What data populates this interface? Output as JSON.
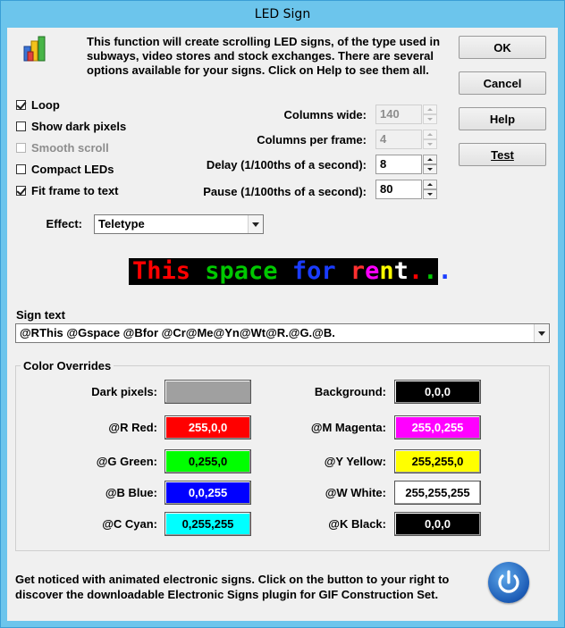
{
  "window": {
    "title": "LED Sign"
  },
  "intro": {
    "line1": "This function will create scrolling LED signs, of the type used in",
    "line2": "subways, video stores and stock exchanges. There are several",
    "line3": "options available for your signs. Click on Help to see them all."
  },
  "buttons": {
    "ok": "OK",
    "cancel": "Cancel",
    "help": "Help",
    "test": "Test"
  },
  "options": [
    {
      "label": "Loop",
      "checked": true,
      "disabled": false
    },
    {
      "label": "Show dark pixels",
      "checked": false,
      "disabled": false
    },
    {
      "label": "Smooth scroll",
      "checked": false,
      "disabled": true
    },
    {
      "label": "Compact LEDs",
      "checked": false,
      "disabled": false
    },
    {
      "label": "Fit frame to text",
      "checked": true,
      "disabled": false
    }
  ],
  "fields": {
    "columns_wide": {
      "label": "Columns wide:",
      "value": "140"
    },
    "columns_per_frame": {
      "label": "Columns per frame:",
      "value": "4"
    },
    "delay": {
      "label": "Delay (1/100ths of a second):",
      "value": "8"
    },
    "pause": {
      "label": "Pause (1/100ths of a second):",
      "value": "80"
    }
  },
  "effect": {
    "label": "Effect:",
    "value": "Teletype"
  },
  "preview": {
    "segments": [
      {
        "text": "This ",
        "color": "#ff0000"
      },
      {
        "text": "space ",
        "color": "#00c800"
      },
      {
        "text": "for ",
        "color": "#1a3cff"
      },
      {
        "text": "r",
        "color": "#ff3030"
      },
      {
        "text": "e",
        "color": "#ff00ff"
      },
      {
        "text": "n",
        "color": "#ffff00"
      },
      {
        "text": "t",
        "color": "#ffffff"
      },
      {
        "text": ".",
        "color": "#ff0000"
      },
      {
        "text": ".",
        "color": "#00c800"
      },
      {
        "text": ".",
        "color": "#1a3cff"
      }
    ]
  },
  "sign_text": {
    "label": "Sign text",
    "value": "@RThis @Gspace @Bfor @Cr@Me@Yn@Wt@R.@G.@B."
  },
  "color_overrides": {
    "title": "Color Overrides",
    "left": [
      {
        "label": "Dark pixels:",
        "value": "",
        "bg": "#a0a0a0",
        "fg": "#000000"
      },
      {
        "label": "@R Red:",
        "value": "255,0,0",
        "bg": "#ff0000",
        "fg": "#ffffff"
      },
      {
        "label": "@G Green:",
        "value": "0,255,0",
        "bg": "#00ff00",
        "fg": "#000000"
      },
      {
        "label": "@B Blue:",
        "value": "0,0,255",
        "bg": "#0000ff",
        "fg": "#ffffff"
      },
      {
        "label": "@C Cyan:",
        "value": "0,255,255",
        "bg": "#00ffff",
        "fg": "#000000"
      }
    ],
    "right": [
      {
        "label": "Background:",
        "value": "0,0,0",
        "bg": "#000000",
        "fg": "#ffffff"
      },
      {
        "label": "@M Magenta:",
        "value": "255,0,255",
        "bg": "#ff00ff",
        "fg": "#ffffff"
      },
      {
        "label": "@Y Yellow:",
        "value": "255,255,0",
        "bg": "#ffff00",
        "fg": "#000000"
      },
      {
        "label": "@W White:",
        "value": "255,255,255",
        "bg": "#ffffff",
        "fg": "#000000"
      },
      {
        "label": "@K Black:",
        "value": "0,0,0",
        "bg": "#000000",
        "fg": "#ffffff"
      }
    ]
  },
  "footer": {
    "line1": "Get noticed with animated electronic signs. Click on the button to your right to",
    "line2": "discover the downloadable Electronic Signs plugin for GIF Construction Set."
  },
  "icons": {
    "app": "bar-chart-icon",
    "power": "power-icon"
  }
}
